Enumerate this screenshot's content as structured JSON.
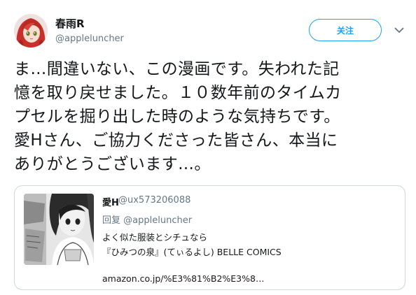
{
  "author": {
    "display_name": "春雨R",
    "screen_name": "@appleluncher",
    "avatar_icon": "anime-girl-avatar"
  },
  "actions": {
    "follow_label": "关注",
    "caret_icon": "chevron-down-icon"
  },
  "tweet": {
    "lines": [
      "ま…間違いない、この漫画です。失われた記",
      "憶を取り戻せました。１０数年前のタイムカ",
      "プセルを掘り出した時のような気持ちです。",
      "愛Hさん、ご協力くださった皆さん、本当に",
      "ありがとうございます…。"
    ]
  },
  "quote": {
    "author_name": "愛H",
    "author_handle": "@ux573206088",
    "reply_prefix": "回复",
    "reply_to": "@appleluncher",
    "body_lines": [
      "よく似た服装とシチュなら",
      "『ひみつの泉』(てぃるよし) BELLE  COMICS"
    ],
    "link": "amazon.co.jp/%E3%81%B2%E3%8…",
    "media_icon": "manga-page-thumbnail"
  },
  "colors": {
    "accent": "#1da1f2",
    "text": "#14171a",
    "secondary": "#657786",
    "border": "#ccd6dd"
  }
}
